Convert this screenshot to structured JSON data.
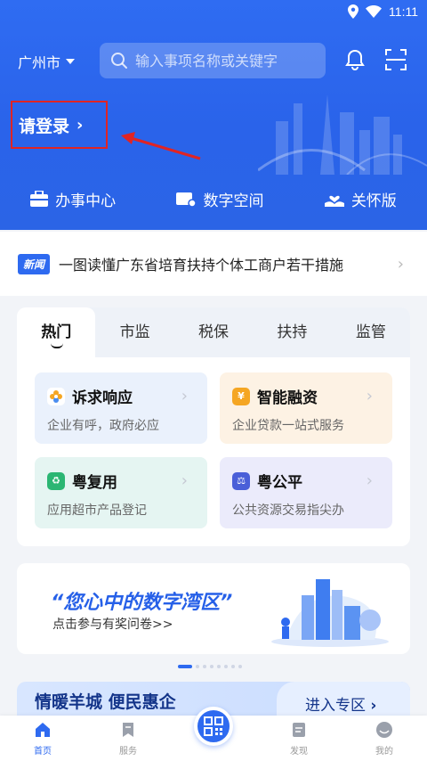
{
  "status_bar": {
    "time": "11:11"
  },
  "header": {
    "city": "广州市",
    "search_placeholder": "输入事项名称或关键字",
    "login_label": "请登录",
    "quick_nav": [
      {
        "label": "办事中心",
        "icon": "briefcase-icon"
      },
      {
        "label": "数字空间",
        "icon": "folder-icon"
      },
      {
        "label": "关怀版",
        "icon": "care-hand-icon"
      }
    ]
  },
  "news": {
    "badge": "新闻",
    "text": "一图读懂广东省培育扶持个体工商户若干措施"
  },
  "tabs": [
    "热门",
    "市监",
    "税保",
    "扶持",
    "监管"
  ],
  "services": [
    {
      "title": "诉求响应",
      "desc": "企业有呼，政府必应",
      "icon": "flower-icon",
      "color": "#f5a623"
    },
    {
      "title": "智能融资",
      "desc": "企业贷款一站式服务",
      "icon": "yen-icon",
      "color": "#f5a623"
    },
    {
      "title": "粤复用",
      "desc": "应用超市产品登记",
      "icon": "recycle-icon",
      "color": "#2bb673"
    },
    {
      "title": "粤公平",
      "desc": "公共资源交易指尖办",
      "icon": "scale-icon",
      "color": "#4a5fd8"
    }
  ],
  "banner": {
    "title": "“您心中的数字湾区”",
    "subtitle": "点击参与有奖问卷>>"
  },
  "promo": {
    "title": "情暖羊城 便民惠企",
    "button": "进入专区"
  },
  "bottom_nav": [
    {
      "label": "首页",
      "icon": "home-icon",
      "active": true
    },
    {
      "label": "服务",
      "icon": "bookmark-icon",
      "active": false
    },
    {
      "label": "发现",
      "icon": "discover-icon",
      "active": false
    },
    {
      "label": "我的",
      "icon": "user-icon",
      "active": false
    }
  ],
  "colors": {
    "primary": "#2e6af0",
    "annotation_red": "#e02424"
  }
}
